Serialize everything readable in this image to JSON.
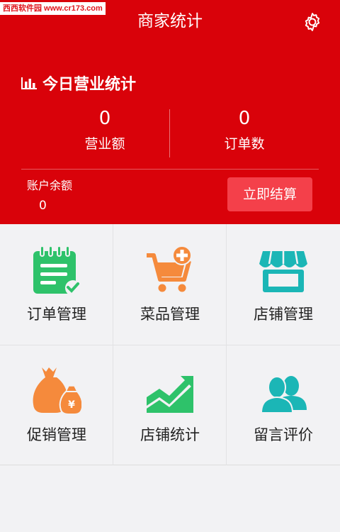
{
  "watermark": "西西软件园 www.cr173.com",
  "header": {
    "title": "商家统计",
    "settings_icon": "gear-icon"
  },
  "stats": {
    "title": "今日营业统计",
    "revenue": {
      "value": "0",
      "label": "营业额"
    },
    "orders": {
      "value": "0",
      "label": "订单数"
    },
    "balance": {
      "label": "账户余额",
      "value": "0"
    },
    "settle_button": "立即结算"
  },
  "menu": [
    {
      "label": "订单管理",
      "icon": "order-notepad-icon",
      "color": "#2ec26a"
    },
    {
      "label": "菜品管理",
      "icon": "cart-add-icon",
      "color": "#f58a3c"
    },
    {
      "label": "店铺管理",
      "icon": "store-icon",
      "color": "#1bb6b6"
    },
    {
      "label": "促销管理",
      "icon": "money-bag-icon",
      "color": "#f58a3c"
    },
    {
      "label": "店铺统计",
      "icon": "trend-chart-icon",
      "color": "#2ec26a"
    },
    {
      "label": "留言评价",
      "icon": "users-icon",
      "color": "#1bb6b6"
    }
  ],
  "colors": {
    "primary": "#d9020a",
    "button": "#f4404a",
    "background": "#f2f2f4"
  }
}
